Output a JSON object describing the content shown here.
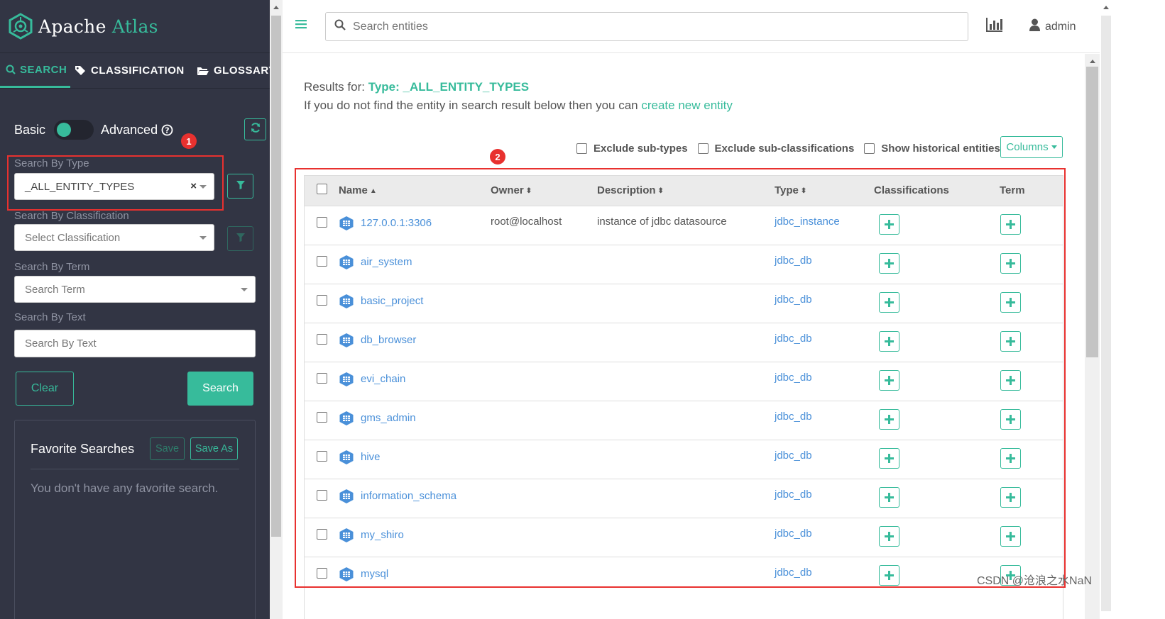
{
  "app": {
    "name_part1": "Apache",
    "name_part2": "Atlas"
  },
  "sidebar": {
    "tabs": [
      {
        "label": "SEARCH",
        "icon": "search-icon"
      },
      {
        "label": "CLASSIFICATION",
        "icon": "tags-icon"
      },
      {
        "label": "GLOSSARY",
        "icon": "folder-open-icon"
      }
    ],
    "toggle": {
      "left_label": "Basic",
      "right_label": "Advanced"
    },
    "search_by_type": {
      "label": "Search By Type",
      "value": "_ALL_ENTITY_TYPES",
      "clear": "×"
    },
    "search_by_classification": {
      "label": "Search By Classification",
      "placeholder": "Select Classification"
    },
    "search_by_term": {
      "label": "Search By Term",
      "placeholder": "Search Term"
    },
    "search_by_text": {
      "label": "Search By Text",
      "placeholder": "Search By Text"
    },
    "clear_button": "Clear",
    "search_button": "Search",
    "favorites": {
      "title": "Favorite Searches",
      "save": "Save",
      "save_as": "Save As",
      "empty": "You don't have any favorite search."
    }
  },
  "markers": {
    "one": "1",
    "two": "2"
  },
  "header": {
    "search_placeholder": "Search entities",
    "user": "admin"
  },
  "results": {
    "prefix": "Results for:",
    "type": "Type: _ALL_ENTITY_TYPES",
    "hint": "If you do not find the entity in search result below then you can",
    "create_link": "create new entity",
    "filters": [
      "Exclude sub-types",
      "Exclude sub-classifications",
      "Show historical entities"
    ],
    "columns_button": "Columns"
  },
  "table": {
    "headers": {
      "name": "Name",
      "owner": "Owner",
      "description": "Description",
      "type": "Type",
      "classifications": "Classifications",
      "term": "Term"
    },
    "rows": [
      {
        "name": "127.0.0.1:3306",
        "owner": "root@localhost",
        "description": "instance of jdbc datasource",
        "type": "jdbc_instance"
      },
      {
        "name": "air_system",
        "owner": "",
        "description": "",
        "type": "jdbc_db"
      },
      {
        "name": "basic_project",
        "owner": "",
        "description": "",
        "type": "jdbc_db"
      },
      {
        "name": "db_browser",
        "owner": "",
        "description": "",
        "type": "jdbc_db"
      },
      {
        "name": "evi_chain",
        "owner": "",
        "description": "",
        "type": "jdbc_db"
      },
      {
        "name": "gms_admin",
        "owner": "",
        "description": "",
        "type": "jdbc_db"
      },
      {
        "name": "hive",
        "owner": "",
        "description": "",
        "type": "jdbc_db"
      },
      {
        "name": "information_schema",
        "owner": "",
        "description": "",
        "type": "jdbc_db"
      },
      {
        "name": "my_shiro",
        "owner": "",
        "description": "",
        "type": "jdbc_db"
      },
      {
        "name": "mysql",
        "owner": "",
        "description": "",
        "type": "jdbc_db"
      }
    ]
  },
  "watermark": "CSDN @沧浪之水NaN",
  "colors": {
    "accent": "#37bb9b",
    "sidebar": "#323544",
    "link": "#4a90d9",
    "marker": "#e8312f"
  }
}
